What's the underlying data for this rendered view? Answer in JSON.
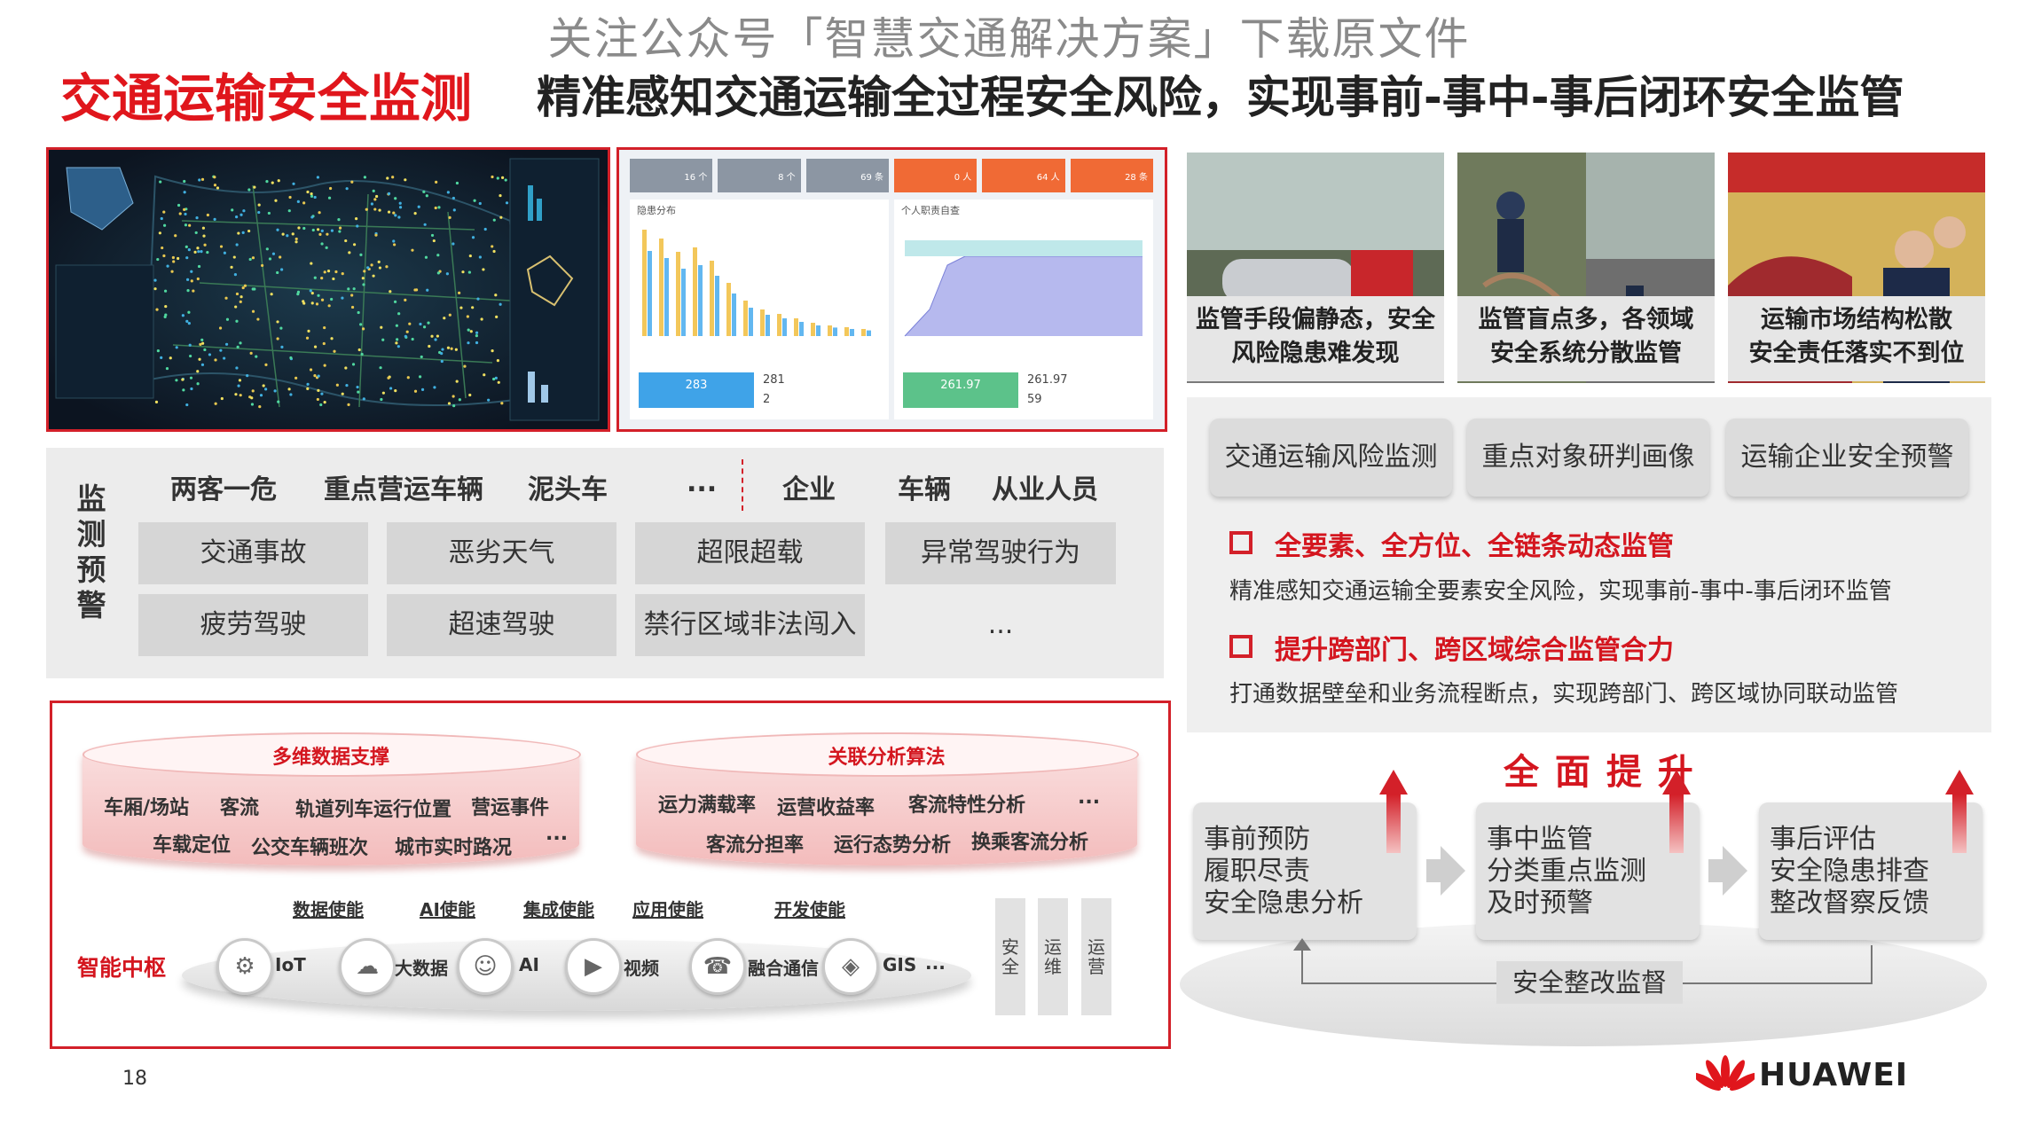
{
  "watermark": "关注公众号「智慧交通解决方案」下载原文件",
  "header": {
    "title": "交通运输安全监测",
    "subtitle": "精准感知交通运输全过程安全风险，实现事前-事中-事后闭环安全监管"
  },
  "dashboard2": {
    "stats": [
      "16 个",
      "8 个",
      "69 条",
      "0 人",
      "64 人",
      "28 条"
    ],
    "left_panel_title": "隐患分布",
    "right_panel_title": "个人职责自查",
    "left_big": "283",
    "left_n1": "281",
    "left_n2": "2",
    "right_big": "261.97",
    "right_n1": "261.97",
    "right_n2": "59"
  },
  "photos": [
    {
      "caption_line1": "监管手段偏静态，安全",
      "caption_line2": "风险隐患难发现"
    },
    {
      "caption_line1": "监管盲点多，各领域",
      "caption_line2": "安全系统分散监管"
    },
    {
      "caption_line1": "运输市场结构松散",
      "caption_line2": "安全责任落实不到位"
    }
  ],
  "monitor": {
    "vertical_label": [
      "监",
      "测",
      "预",
      "警"
    ],
    "headers": [
      "两客一危",
      "重点营运车辆",
      "泥头车",
      "...",
      "企业",
      "车辆",
      "从业人员"
    ],
    "row1": [
      "交通事故",
      "恶劣天气",
      "超限超载",
      "异常驾驶行为"
    ],
    "row2": [
      "疲劳驾驶",
      "超速驾驶",
      "禁行区域非法闯入",
      "..."
    ]
  },
  "hub": {
    "data_title": "多维数据支撑",
    "data_row1": [
      "车厢/场站",
      "客流",
      "轨道列车运行位置",
      "营运事件"
    ],
    "data_row2": [
      "车载定位",
      "公交车辆班次",
      "城市实时路况",
      "..."
    ],
    "algo_title": "关联分析算法",
    "algo_row1": [
      "运力满载率",
      "运营收益率",
      "客流特性分析",
      "..."
    ],
    "algo_row2": [
      "客流分担率",
      "运行态势分析",
      "换乘客流分析"
    ],
    "enable_labels": [
      "数据使能",
      "AI使能",
      "集成使能",
      "应用使能",
      "开发使能"
    ],
    "center_label": "智能中枢",
    "icons": [
      {
        "icon": "iot-icon",
        "label": "IoT"
      },
      {
        "icon": "bigdata-icon",
        "label": "大数据"
      },
      {
        "icon": "ai-icon",
        "label": "AI"
      },
      {
        "icon": "video-icon",
        "label": "视频"
      },
      {
        "icon": "comm-icon",
        "label": "融合通信"
      },
      {
        "icon": "gis-icon",
        "label": "GIS"
      }
    ],
    "icons_more": "...",
    "pillars": [
      "安全",
      "运维",
      "运营"
    ]
  },
  "right": {
    "buttons": [
      "交通运输风险监测",
      "重点对象研判画像",
      "运输企业安全预警"
    ],
    "point1_title": "全要素、全方位、全链条动态监管",
    "point1_text": "精准感知交通运输全要素安全风险，实现事前-事中-事后闭环监管",
    "point2_title": "提升跨部门、跨区域综合监管合力",
    "point2_text": "打通数据壁垒和业务流程断点，实现跨部门、跨区域协同联动监管",
    "upgrade": "全 面 提 升",
    "stages": [
      [
        "事前预防",
        "履职尽责",
        "安全隐患分析"
      ],
      [
        "事中监管",
        "分类重点监测",
        "及时预警"
      ],
      [
        "事后评估",
        "安全隐患排查",
        "整改督察反馈"
      ]
    ],
    "loop_label": "安全整改监督"
  },
  "footer": {
    "page": "18",
    "brand": "HUAWEI"
  },
  "colors": {
    "accent": "#d32029",
    "panel": "#ececec",
    "box": "#d6d6d6"
  }
}
